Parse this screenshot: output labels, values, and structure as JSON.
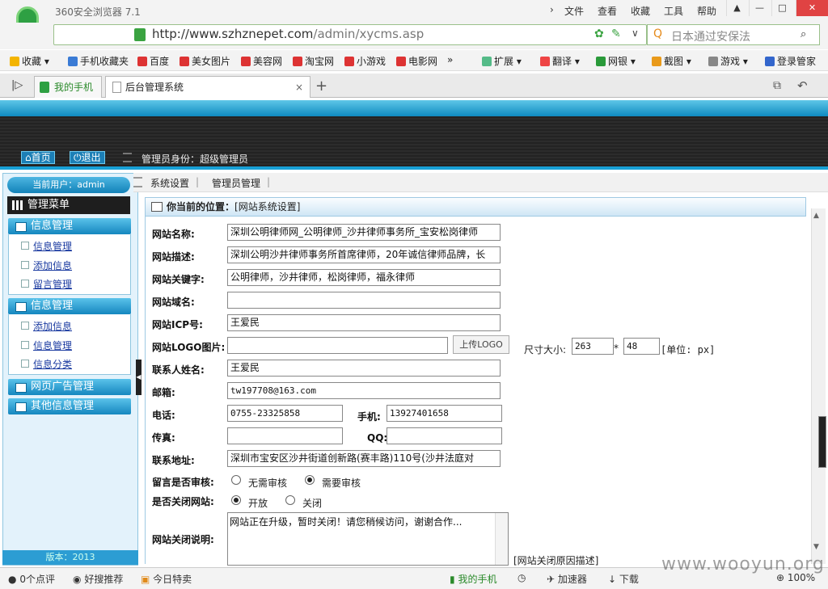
{
  "browser": {
    "app_title": "360安全浏览器 7.1",
    "menu": [
      "文件",
      "查看",
      "收藏",
      "工具",
      "帮助"
    ],
    "url_host": "http://www.szhznepet.com",
    "url_path": "/admin/xycms.asp",
    "search_placeholder": "日本通过安保法",
    "bookmarks": [
      "收藏",
      "手机收藏夹",
      "百度",
      "美女图片",
      "美容网",
      "淘宝网",
      "小游戏",
      "电影网"
    ],
    "tools": [
      "扩展",
      "翻译",
      "网银",
      "截图",
      "游戏",
      "登录管家"
    ],
    "tabs": [
      "我的手机",
      "后台管理系统"
    ]
  },
  "header": {
    "home_btn": "首页",
    "logout_btn": "退出",
    "identity": "管理员身份：超级管理员"
  },
  "sidebar": {
    "current_user": "当前用户：admin",
    "menu_title": "管理菜单",
    "groups": [
      {
        "title": "信息管理",
        "items": [
          "信息管理",
          "添加信息",
          "留言管理"
        ]
      },
      {
        "title": "信息管理",
        "items": [
          "添加信息",
          "信息管理",
          "信息分类"
        ]
      },
      {
        "title": "网页广告管理",
        "items": []
      },
      {
        "title": "其他信息管理",
        "items": []
      }
    ],
    "version": "版本：2013"
  },
  "topnav": [
    "系统设置",
    "管理员管理"
  ],
  "breadcrumb": {
    "label": "你当前的位置：",
    "value": "[网站系统设置]"
  },
  "form": {
    "site_name": {
      "label": "网站名称:",
      "value": "深圳公明律师网_公明律师_沙井律师事务所_宝安松岗律师"
    },
    "site_desc": {
      "label": "网站描述:",
      "value": "深圳公明沙井律师事务所首席律师，20年诚信律师品牌，长"
    },
    "site_keywords": {
      "label": "网站关键字:",
      "value": "公明律师，沙井律师，松岗律师，福永律师"
    },
    "site_domain": {
      "label": "网站域名:",
      "value": ""
    },
    "site_icp": {
      "label": "网站ICP号:",
      "value": "王爱民"
    },
    "logo": {
      "label": "网站LOGO图片:",
      "value": "",
      "upload_btn": "上传LOGO",
      "size_label": "尺寸大小:",
      "width": "263",
      "times": "*",
      "height": "48",
      "unit": "[单位: px]"
    },
    "contact": {
      "label": "联系人姓名:",
      "value": "王爱民"
    },
    "email": {
      "label": "邮箱:",
      "value": "tw197708@163.com"
    },
    "phone": {
      "label": "电话:",
      "value": "0755-23325858"
    },
    "mobile": {
      "label": "手机:",
      "value": "13927401658"
    },
    "fax": {
      "label": "传真:",
      "value": ""
    },
    "qq": {
      "label": "QQ:",
      "value": ""
    },
    "address": {
      "label": "联系地址:",
      "value": "深圳市宝安区沙井街道创新路(赛丰路)110号(沙井法庭对"
    },
    "msg_review": {
      "label": "留言是否审核:",
      "opt1": "无需审核",
      "opt2": "需要审核"
    },
    "close_site": {
      "label": "是否关闭网站:",
      "opt1": "开放",
      "opt2": "关闭"
    },
    "close_note": {
      "label": "网站关闭说明:",
      "value": "网站正在升级，暂时关闭！请您稍候访问，谢谢合作...",
      "hint": "[网站关闭原因描述]"
    }
  },
  "status": {
    "comments": "0个点评",
    "recommend": "好搜推荐",
    "deals": "今日特卖",
    "myphone": "我的手机",
    "accelerate": "加速器",
    "download": "下载",
    "zoom": "100%"
  },
  "watermark": "www.wooyun.org"
}
